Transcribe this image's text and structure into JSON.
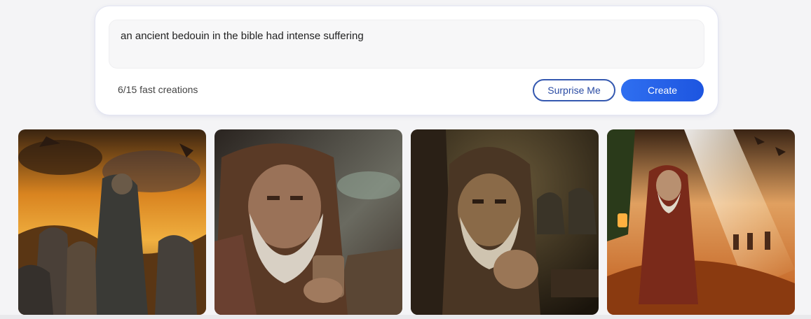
{
  "prompt": {
    "text": "an ancient bedouin in the bible had intense suffering"
  },
  "status": {
    "fast_creations": "6/15 fast creations"
  },
  "buttons": {
    "surprise_label": "Surprise Me",
    "create_label": "Create"
  },
  "colors": {
    "create_button": "#1d55e0",
    "surprise_border": "#3458b0",
    "card_background": "#ffffff",
    "page_background": "#f4f4f6"
  }
}
